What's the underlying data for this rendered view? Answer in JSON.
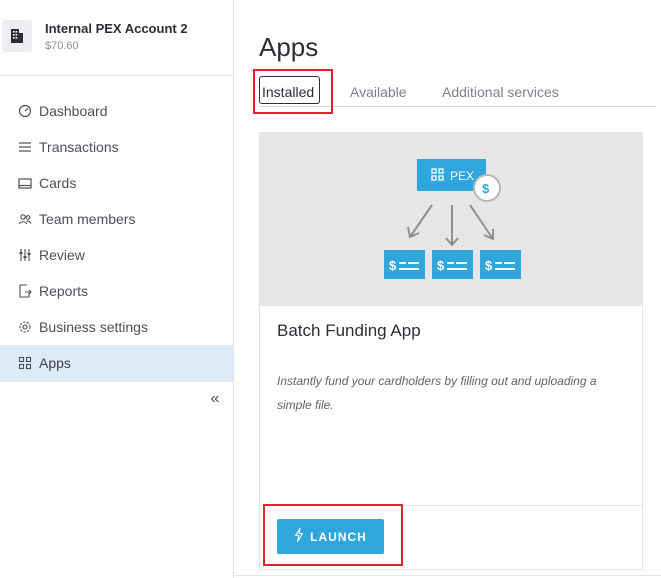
{
  "account": {
    "name": "Internal PEX Account 2",
    "balance": "$70.60",
    "icon": "building-icon"
  },
  "nav": {
    "items": [
      {
        "label": "Dashboard",
        "icon": "dashboard-gauge-icon"
      },
      {
        "label": "Transactions",
        "icon": "list-icon"
      },
      {
        "label": "Cards",
        "icon": "card-icon"
      },
      {
        "label": "Team members",
        "icon": "team-icon"
      },
      {
        "label": "Review",
        "icon": "sliders-icon"
      },
      {
        "label": "Reports",
        "icon": "report-export-icon"
      },
      {
        "label": "Business settings",
        "icon": "gear-icon"
      },
      {
        "label": "Apps",
        "icon": "grid-icon",
        "active": true
      }
    ],
    "collapse_glyph": "«"
  },
  "page": {
    "title": "Apps"
  },
  "tabs": [
    {
      "label": "Installed",
      "selected": true
    },
    {
      "label": "Available"
    },
    {
      "label": "Additional services"
    }
  ],
  "app_card": {
    "hero_logo_text": "PEX",
    "hero_coin": "$",
    "title": "Batch Funding App",
    "description": "Instantly fund your cardholders by filling out and uploading a simple file.",
    "launch_label": "LAUNCH"
  },
  "colors": {
    "accent": "#2fa7dd",
    "active_nav_bg": "#dcebf7",
    "highlight_red": "#e0262d",
    "hero_bg": "#e6e6e6"
  }
}
